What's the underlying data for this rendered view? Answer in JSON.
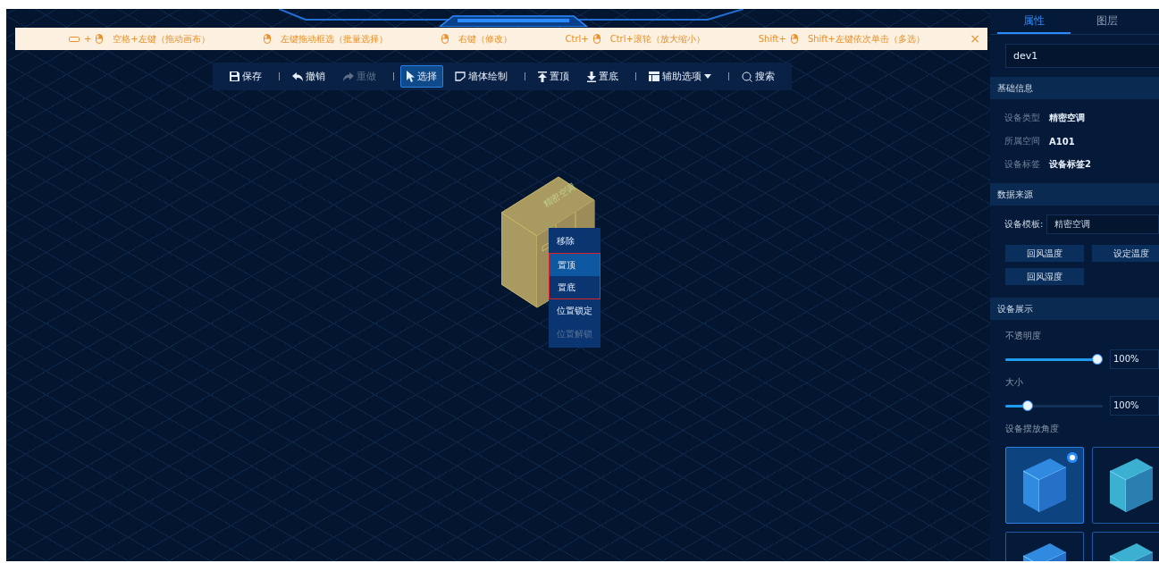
{
  "hints": [
    {
      "kind": "space-combo",
      "key": "+",
      "label": "空格+左键（拖动画布）"
    },
    {
      "kind": "mouse",
      "label": "左键拖动框选（批量选择）"
    },
    {
      "kind": "mouse",
      "label": "右键（修改）"
    },
    {
      "kind": "mouse",
      "key": "Ctrl+",
      "label": "Ctrl+滚轮（放大缩小）"
    },
    {
      "kind": "mouse",
      "key": "Shift+",
      "label": "Shift+左键依次单击（多选）"
    }
  ],
  "close_hint": "×",
  "toolbar": [
    {
      "kind": "save",
      "label": "保存",
      "disabled": false,
      "selected": false,
      "separator_after": true,
      "dropdown": false
    },
    {
      "kind": "undo",
      "label": "撤销",
      "disabled": false,
      "selected": false,
      "separator_after": false,
      "dropdown": false
    },
    {
      "kind": "redo",
      "label": "重做",
      "disabled": true,
      "selected": false,
      "separator_after": true,
      "dropdown": false
    },
    {
      "kind": "pointer",
      "label": "选择",
      "disabled": false,
      "selected": true,
      "separator_after": false,
      "dropdown": false
    },
    {
      "kind": "wall",
      "label": "墙体绘制",
      "disabled": false,
      "selected": false,
      "separator_after": true,
      "dropdown": false
    },
    {
      "kind": "top",
      "label": "置顶",
      "disabled": false,
      "selected": false,
      "separator_after": false,
      "dropdown": false
    },
    {
      "kind": "bottom",
      "label": "置底",
      "disabled": false,
      "selected": false,
      "separator_after": true,
      "dropdown": false
    },
    {
      "kind": "layout",
      "label": "辅助选项",
      "disabled": false,
      "selected": false,
      "separator_after": true,
      "dropdown": true
    },
    {
      "kind": "search",
      "label": "搜索",
      "disabled": false,
      "selected": false,
      "separator_after": false,
      "dropdown": false
    }
  ],
  "device": {
    "label": "精密空调"
  },
  "context_menu": [
    {
      "label": "移除",
      "selected": false,
      "disabled": false,
      "outlined": false
    },
    {
      "label": "置顶",
      "selected": true,
      "disabled": false,
      "outlined": true
    },
    {
      "label": "置底",
      "selected": false,
      "disabled": false,
      "outlined": true
    },
    {
      "label": "位置锁定",
      "selected": false,
      "disabled": false,
      "outlined": false
    },
    {
      "label": "位置解锁",
      "selected": false,
      "disabled": true,
      "outlined": false
    }
  ],
  "panel": {
    "tabs": [
      {
        "label": "属性",
        "selected": true
      },
      {
        "label": "图层",
        "selected": false
      }
    ],
    "name": "dev1",
    "basic": {
      "title": "基础信息",
      "rows": [
        {
          "label": "设备类型",
          "value": "精密空调"
        },
        {
          "label": "所属空间",
          "value": "A101"
        },
        {
          "label": "设备标签",
          "value": "设备标签2"
        }
      ]
    },
    "source": {
      "title": "数据来源",
      "template_label": "设备模板:",
      "template_value": "精密空调",
      "buttons": [
        "回风温度",
        "设定温度",
        "回风湿度"
      ]
    },
    "display": {
      "title": "设备展示",
      "sliders": [
        {
          "label": "不透明度",
          "level": 1.0,
          "value": "100%"
        },
        {
          "label": "大小",
          "level": 0.2,
          "value": "100%"
        }
      ],
      "angle_label": "设备摆放角度",
      "angles": [
        {
          "selected": true
        },
        {
          "selected": false
        },
        {
          "selected": false
        },
        {
          "selected": false
        }
      ]
    }
  }
}
